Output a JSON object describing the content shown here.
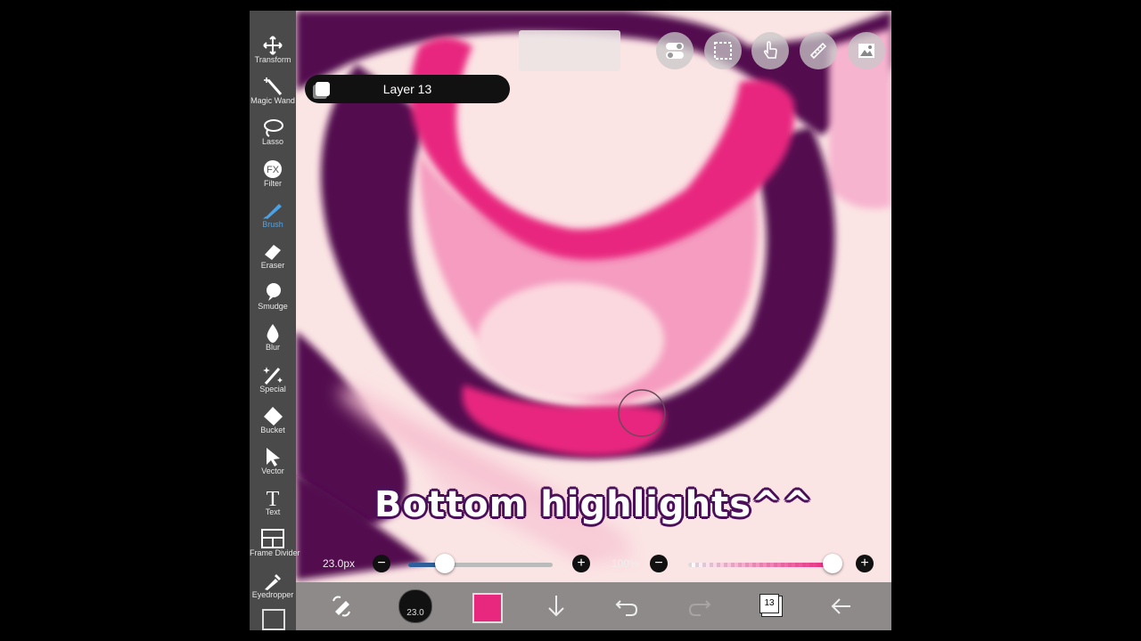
{
  "toolbar": {
    "items": [
      {
        "label": "Transform",
        "icon": "move-arrows-icon"
      },
      {
        "label": "Magic Wand",
        "icon": "magic-wand-icon"
      },
      {
        "label": "Lasso",
        "icon": "lasso-icon"
      },
      {
        "label": "Filter",
        "icon": "fx-icon"
      },
      {
        "label": "Brush",
        "icon": "brush-icon",
        "active": true
      },
      {
        "label": "Eraser",
        "icon": "eraser-icon"
      },
      {
        "label": "Smudge",
        "icon": "smudge-icon"
      },
      {
        "label": "Blur",
        "icon": "droplet-icon"
      },
      {
        "label": "Special",
        "icon": "sparkle-pen-icon"
      },
      {
        "label": "Bucket",
        "icon": "bucket-icon"
      },
      {
        "label": "Vector",
        "icon": "pointer-arrow-icon"
      },
      {
        "label": "Text",
        "icon": "text-t-icon"
      },
      {
        "label": "Frame Divider",
        "icon": "frame-divider-icon"
      },
      {
        "label": "Eyedropper",
        "icon": "eyedropper-icon"
      }
    ],
    "filter_glyph": "FX",
    "text_glyph": "T"
  },
  "layer": {
    "name": "Layer 13"
  },
  "subtitle": "Bottom highlights^^",
  "sliders": {
    "brush_size_value": "23.0px",
    "brush_size_fraction": 0.25,
    "opacity_value": "100%",
    "opacity_fraction": 1.0
  },
  "bottom": {
    "brush_size_label": "23.0",
    "layer_count": "13",
    "color": "#e8287f"
  },
  "colors": {
    "toolbar_bg": "#4a4a4a",
    "active_tool": "#4aa3e8",
    "canvas_bg": "#fbe4e4",
    "dark_purple": "#520b4f",
    "hot_pink": "#e8287f",
    "light_pink": "#f59cc0"
  }
}
